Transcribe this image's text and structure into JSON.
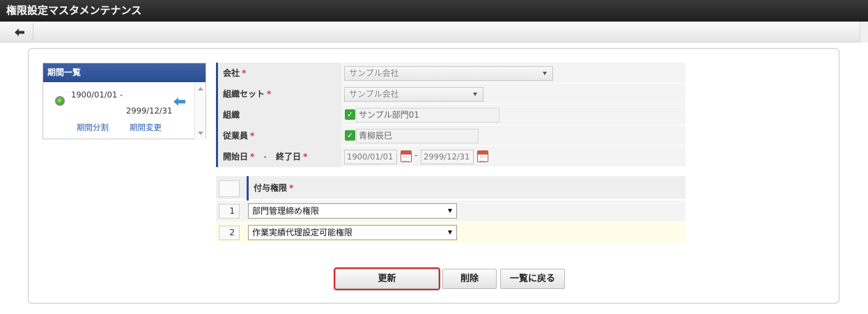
{
  "window": {
    "title": "権限設定マスタメンテナンス"
  },
  "toolbar": {
    "back_icon": "arrow-left-icon"
  },
  "period_list": {
    "header": "期間一覧",
    "start": "1900/01/01  -",
    "end": "2999/12/31",
    "split_link": "期間分割",
    "change_link": "期間変更"
  },
  "form": {
    "company": {
      "label": "会社",
      "required": "*",
      "value": "サンプル会社"
    },
    "org_set": {
      "label": "組織セット",
      "required": "*",
      "value": "サンプル会社"
    },
    "org": {
      "label": "組織",
      "value": "サンプル部門01"
    },
    "employee": {
      "label": "従業員",
      "required": "*",
      "value": "青柳辰巳"
    },
    "dates": {
      "start_label": "開始日",
      "start_required": "*",
      "separator": "-",
      "end_label": "終了日",
      "end_required": "*",
      "start_value": "1900/01/01",
      "range_sep": "-",
      "end_value": "2999/12/31"
    }
  },
  "grants": {
    "header_label": "付与権限",
    "header_required": "*",
    "rows": [
      {
        "num": "1",
        "value": "部門管理締め権限"
      },
      {
        "num": "2",
        "value": "作業実績代理設定可能権限"
      }
    ]
  },
  "buttons": {
    "update": "更新",
    "delete": "削除",
    "back": "一覧に戻る"
  },
  "colors": {
    "title_bar": "#262626",
    "section_header": "#2d4e8e",
    "accent_red": "#d7262b",
    "check_green": "#3aa43a",
    "link_blue": "#2a5fb0"
  }
}
